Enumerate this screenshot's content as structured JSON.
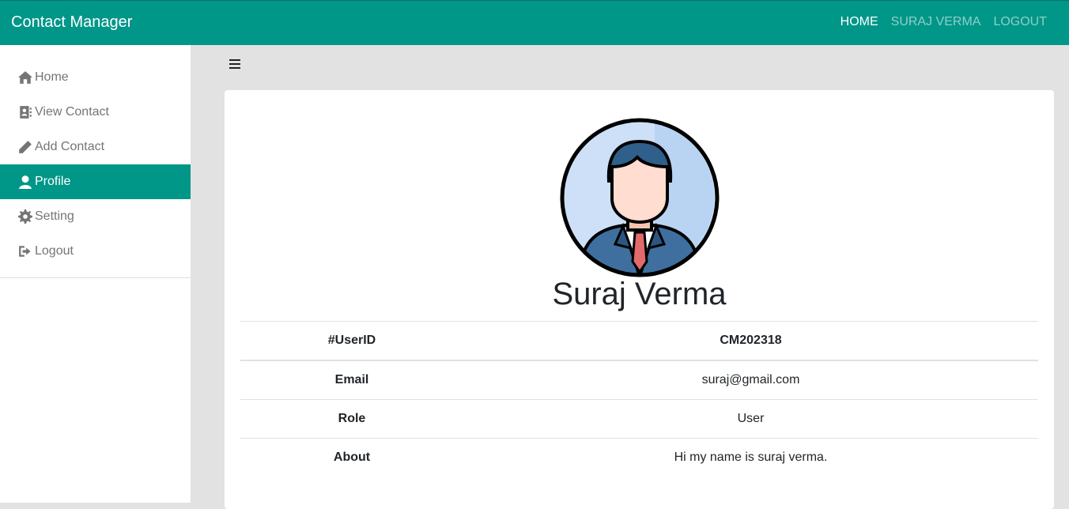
{
  "app": {
    "title": "Contact Manager"
  },
  "navbar": {
    "links": [
      {
        "label": "HOME"
      },
      {
        "label": "SURAJ VERMA"
      },
      {
        "label": "LOGOUT"
      }
    ]
  },
  "sidebar": {
    "items": [
      {
        "label": "Home",
        "icon": "home-icon"
      },
      {
        "label": "View Contact",
        "icon": "address-book-icon"
      },
      {
        "label": "Add Contact",
        "icon": "pencil-icon"
      },
      {
        "label": "Profile",
        "icon": "user-icon",
        "active": true
      },
      {
        "label": "Setting",
        "icon": "gear-icon"
      },
      {
        "label": "Logout",
        "icon": "sign-out-icon"
      }
    ]
  },
  "profile": {
    "name": "Suraj Verma",
    "rows": [
      {
        "key": "#UserID",
        "value": "CM202318"
      },
      {
        "key": "Email",
        "value": "suraj@gmail.com"
      },
      {
        "key": "Role",
        "value": "User"
      },
      {
        "key": "About",
        "value": "Hi my name is suraj verma."
      }
    ]
  },
  "colors": {
    "primary": "#009688",
    "background": "#e2e2e2"
  }
}
